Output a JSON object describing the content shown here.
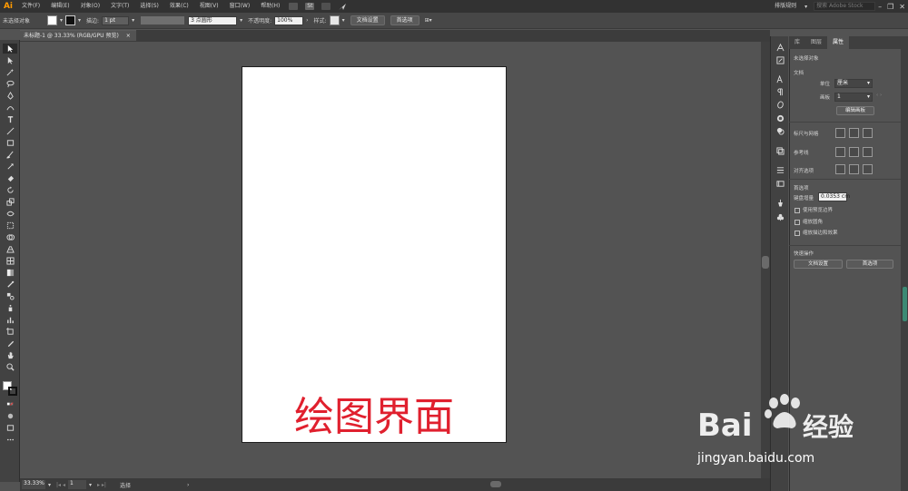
{
  "app": {
    "logo": "Ai"
  },
  "menu": {
    "items": [
      "文件(F)",
      "编辑(E)",
      "对象(O)",
      "文字(T)",
      "选择(S)",
      "效果(C)",
      "视图(V)",
      "窗口(W)",
      "帮助(H)"
    ],
    "br_badge": "Br",
    "st_badge": "St",
    "workspace": "排版规则",
    "search_placeholder": "搜索 Adobe Stock"
  },
  "control_bar": {
    "selection_label": "未选择对象",
    "stroke_label": "描边:",
    "stroke_value": "1 pt",
    "brush_value": "3 点圆形",
    "opacity_label": "不透明度:",
    "opacity_value": "100%",
    "style_label": "样式:",
    "doc_setup_button": "文档设置",
    "prefs_button": "首选项"
  },
  "document": {
    "tab_title": "未标题-1 @ 33.33% (RGB/GPU 预览)",
    "close_glyph": "×"
  },
  "status": {
    "zoom": "33.33%",
    "artboard_num": "1",
    "tool_label": "选择"
  },
  "panel": {
    "tabs": [
      "库",
      "图层",
      "属性"
    ],
    "active_tab": 2,
    "no_selection": "未选择对象",
    "document_header": "文档",
    "unit_label": "单位",
    "unit_value": "厘米",
    "artboard_label": "画板",
    "artboard_value": "1",
    "edit_artboards_button": "编辑画板",
    "rulers_grids_label": "标尺与网格",
    "guides_label": "参考线",
    "align_options_label": "对齐选项",
    "preferences_header": "首选项",
    "keyboard_increment_label": "键盘增量",
    "keyboard_increment_value": "0.0353",
    "keyboard_increment_unit": "cm",
    "checkboxes": [
      "使用预览边界",
      "缩放圆角",
      "缩放描边和效果"
    ],
    "quick_actions_header": "快速操作",
    "quick_doc_setup_button": "文档设置",
    "quick_prefs_button": "首选项"
  },
  "overlay": {
    "caption": "绘图界面",
    "watermark_brand": "Bai 经验",
    "watermark_url": "jingyan.baidu.com"
  },
  "colors": {
    "menubar": "#323232",
    "canvas": "#535353",
    "caption": "#e0202e",
    "logo": "#ff9a00"
  }
}
